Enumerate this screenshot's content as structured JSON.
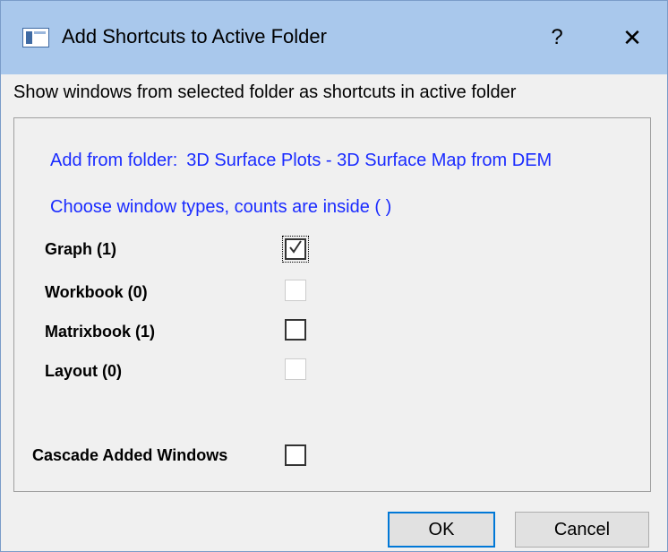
{
  "window": {
    "title": "Add Shortcuts to Active Folder",
    "help_label": "?",
    "close_label": "✕",
    "icon": "app-window-icon"
  },
  "description": "Show windows from selected folder as shortcuts in active folder",
  "group": {
    "folder_prefix": "Add from folder:",
    "folder_name": "3D Surface Plots - 3D Surface Map from DEM",
    "choose_text": "Choose window types, counts are inside ( )",
    "items": [
      {
        "label": "Graph (1)",
        "checked": true,
        "enabled": true
      },
      {
        "label": "Workbook (0)",
        "checked": false,
        "enabled": false
      },
      {
        "label": "Matrixbook (1)",
        "checked": false,
        "enabled": true
      },
      {
        "label": "Layout (0)",
        "checked": false,
        "enabled": false
      }
    ],
    "cascade": {
      "label": "Cascade Added Windows",
      "checked": false,
      "enabled": true
    }
  },
  "buttons": {
    "ok": "OK",
    "cancel": "Cancel"
  },
  "colors": {
    "titlebar": "#a9c8ec",
    "link_text": "#1a2bff",
    "default_button_border": "#0078d7"
  }
}
